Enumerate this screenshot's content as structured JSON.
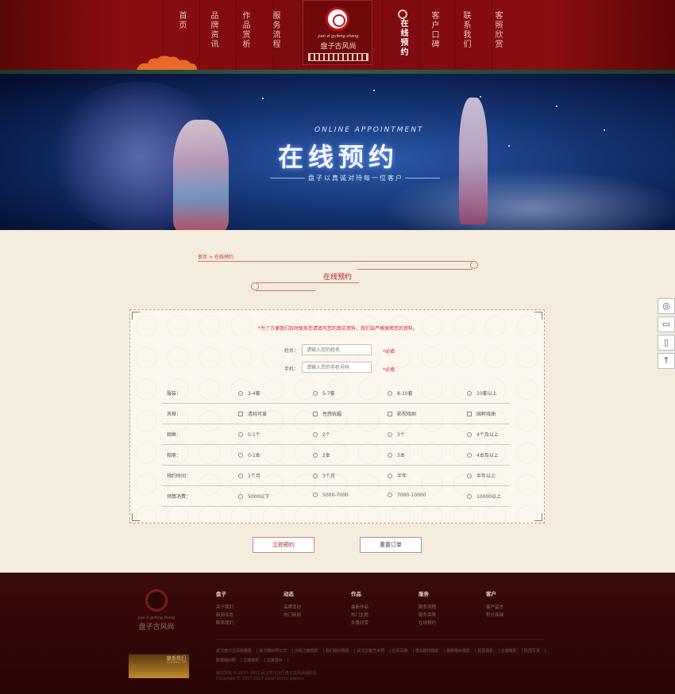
{
  "nav": {
    "items": [
      {
        "label": "首页"
      },
      {
        "label": "品牌资讯"
      },
      {
        "label": "作品赏析"
      },
      {
        "label": "服务流程"
      },
      {
        "label": "在线预约"
      },
      {
        "label": "客户口碑"
      },
      {
        "label": "联系我们"
      },
      {
        "label": "客照欣赏"
      }
    ],
    "logo_en": "pan zi gufeng shang",
    "logo_cn": "盘子古风尚"
  },
  "banner": {
    "en": "ONLINE APPOINTMENT",
    "cn": "在线预约",
    "sub": "盘子以真诚对待每一位客户"
  },
  "breadcrumb": {
    "home": "首页",
    "sep": ">",
    "current": "在线预约"
  },
  "section_title": "在线预约",
  "form": {
    "notice": "*为了方便我们及时联系您请填写您的真实资料，我们会严格保密您的资料。",
    "name": {
      "label": "姓名：",
      "placeholder": "请输入您的姓名",
      "required": "*必填"
    },
    "phone": {
      "label": "手机：",
      "placeholder": "请输入您的手机号码",
      "required": "*必填"
    },
    "rows": [
      {
        "label": "服装：",
        "type": "radio",
        "options": [
          "3-4套",
          "5-7套",
          "8-10套",
          "10套以上"
        ]
      },
      {
        "label": "风格：",
        "type": "checkbox",
        "options": [
          "清纯可爱",
          "性感妩媚",
          "影视戏剧",
          "国粹戏曲"
        ]
      },
      {
        "label": "相框：",
        "type": "radio",
        "options": [
          "0-1个",
          "2个",
          "3个",
          "4个及以上"
        ]
      },
      {
        "label": "相册：",
        "type": "radio",
        "options": [
          "0-1本",
          "2本",
          "3本",
          "4本及以上"
        ]
      },
      {
        "label": "预约时间：",
        "type": "radio",
        "options": [
          "1个月",
          "3个月",
          "半年",
          "半年以上"
        ]
      },
      {
        "label": "预算消费：",
        "type": "radio",
        "options": [
          "5000以下",
          "5000-7000",
          "7000-10000",
          "10000以上"
        ]
      }
    ],
    "submit": "立即预约",
    "reset": "重置订单"
  },
  "footer": {
    "logo_en": "pan zi gufeng shang",
    "logo_cn": "盘子古风尚",
    "badge_title": "联系我们",
    "badge_sub": "Contact Us",
    "columns": [
      {
        "title": "盘子",
        "items": [
          "关于我们",
          "新闻动态",
          "联系我们"
        ]
      },
      {
        "title": "动态",
        "items": [
          "品牌活动",
          "热门新闻"
        ]
      },
      {
        "title": "作品",
        "items": [
          "最新作品",
          "热门主题",
          "外景欣赏"
        ]
      },
      {
        "title": "服务",
        "items": [
          "服务流程",
          "服务保障",
          "在线预约"
        ]
      },
      {
        "title": "客户",
        "items": [
          "客户留言",
          "积分商城"
        ]
      }
    ],
    "links": [
      "武汉盘子古风尚摄影",
      "武汉婚纱照公司",
      "汉街古装摄影",
      "我们婚纱摄影",
      "武汉古装艺术照",
      "古风写真",
      "唐仙服饰摄影",
      "最新婚纱摄影",
      "民国摄影",
      "古装摄影",
      "民国写真",
      "影楼婚纱照",
      "古装摄影",
      "古装婚纱"
    ],
    "copy1": "版权所有 © 2017-2017 武汉市江汉区盘子古风尚摄影馆",
    "copy2": "Copyright © 2017-2017 panzi photo agency"
  },
  "side": {
    "items": [
      "wechat-icon",
      "chat-icon",
      "phone-icon",
      "top-icon"
    ]
  }
}
